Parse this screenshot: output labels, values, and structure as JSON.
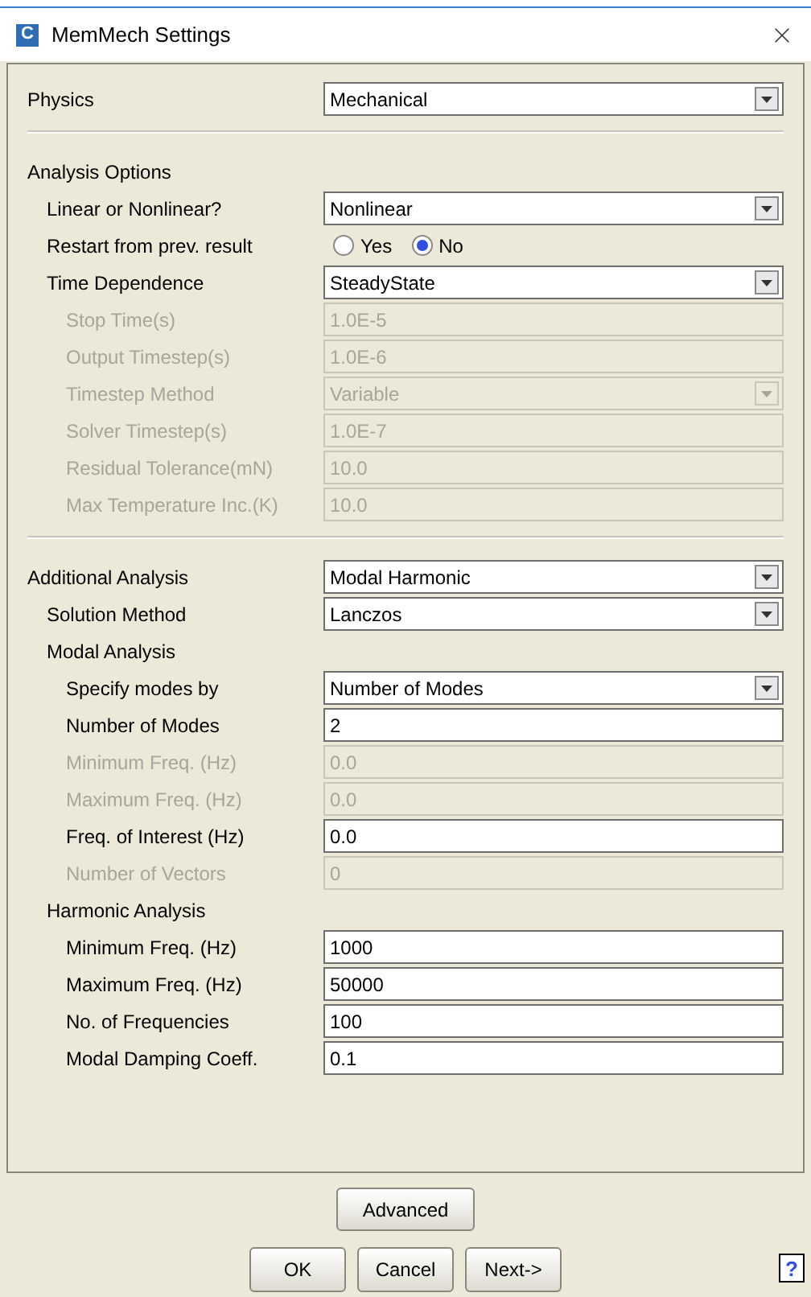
{
  "window": {
    "title": "MemMech Settings",
    "logo_letter": "C"
  },
  "groups": [
    [
      {
        "kind": "select",
        "label": "Physics",
        "value": "Mechanical",
        "disabled": false
      }
    ],
    [
      {
        "kind": "heading",
        "label": "Analysis Options",
        "children": [
          {
            "kind": "select",
            "label": "Linear or Nonlinear?",
            "value": "Nonlinear",
            "disabled": false
          },
          {
            "kind": "radio",
            "label": "Restart from prev. result",
            "options": [
              {
                "label": "Yes",
                "selected": false
              },
              {
                "label": "No",
                "selected": true
              }
            ]
          },
          {
            "kind": "select",
            "label": "Time Dependence",
            "value": "SteadyState",
            "disabled": false,
            "children": [
              {
                "kind": "text",
                "label": "Stop Time(s)",
                "value": "1.0E-5",
                "disabled": true
              },
              {
                "kind": "text",
                "label": "Output Timestep(s)",
                "value": "1.0E-6",
                "disabled": true
              },
              {
                "kind": "select",
                "label": "Timestep Method",
                "value": "Variable",
                "disabled": true
              },
              {
                "kind": "text",
                "label": "Solver Timestep(s)",
                "value": "1.0E-7",
                "disabled": true
              },
              {
                "kind": "text",
                "label": "Residual Tolerance(mN)",
                "value": "10.0",
                "disabled": true
              },
              {
                "kind": "text",
                "label": "Max Temperature Inc.(K)",
                "value": "10.0",
                "disabled": true
              }
            ]
          }
        ]
      }
    ],
    [
      {
        "kind": "select",
        "label": "Additional Analysis",
        "value": "Modal Harmonic",
        "disabled": false,
        "children": [
          {
            "kind": "select",
            "label": "Solution Method",
            "value": "Lanczos",
            "disabled": false
          },
          {
            "kind": "heading",
            "label": "Modal Analysis",
            "children": [
              {
                "kind": "select",
                "label": "Specify modes by",
                "value": "Number of Modes",
                "disabled": false
              },
              {
                "kind": "text",
                "label": "Number of Modes",
                "value": "2",
                "disabled": false
              },
              {
                "kind": "text",
                "label": "Minimum Freq. (Hz)",
                "value": "0.0",
                "disabled": true
              },
              {
                "kind": "text",
                "label": "Maximum Freq. (Hz)",
                "value": "0.0",
                "disabled": true
              },
              {
                "kind": "text",
                "label": "Freq. of Interest (Hz)",
                "value": "0.0",
                "disabled": false
              },
              {
                "kind": "text",
                "label": "Number of Vectors",
                "value": "0",
                "disabled": true
              }
            ]
          },
          {
            "kind": "heading",
            "label": "Harmonic Analysis",
            "children": [
              {
                "kind": "text",
                "label": "Minimum Freq. (Hz)",
                "value": "1000",
                "disabled": false
              },
              {
                "kind": "text",
                "label": "Maximum Freq. (Hz)",
                "value": "50000",
                "disabled": false
              },
              {
                "kind": "text",
                "label": "No. of Frequencies",
                "value": "100",
                "disabled": false
              },
              {
                "kind": "text",
                "label": "Modal Damping Coeff.",
                "value": "0.1",
                "disabled": false
              }
            ]
          }
        ]
      }
    ]
  ],
  "advanced_button": "Advanced",
  "buttons": [
    "OK",
    "Cancel",
    "Next->"
  ],
  "help": "?"
}
